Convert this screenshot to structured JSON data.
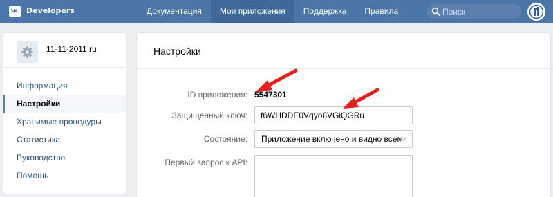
{
  "header": {
    "brand": "Developers",
    "nav": [
      {
        "label": "Документация",
        "active": false
      },
      {
        "label": "Мои приложения",
        "active": true
      },
      {
        "label": "Поддержка",
        "active": false
      },
      {
        "label": "Правила",
        "active": false
      }
    ],
    "search_placeholder": "Поиск",
    "logo_icon": "vk-logo-icon",
    "avatar_icon": "user-avatar"
  },
  "sidebar": {
    "app_name": "11-11-2011.ru",
    "app_icon": "gear-icon",
    "items": [
      {
        "label": "Информация",
        "active": false
      },
      {
        "label": "Настройки",
        "active": true
      },
      {
        "label": "Хранимые процедуры",
        "active": false
      },
      {
        "label": "Статистика",
        "active": false
      },
      {
        "label": "Руководство",
        "active": false
      },
      {
        "label": "Помощь",
        "active": false
      }
    ]
  },
  "main": {
    "title": "Настройки",
    "app_id_label": "ID приложения:",
    "app_id_value": "5547301",
    "secret_key_label": "Защищенный ключ:",
    "secret_key_value": "f6WHDDE0Vqyo8VGiQGRu",
    "state_label": "Состояние:",
    "state_value": "Приложение включено и видно всем",
    "first_api_label": "Первый запрос к API:",
    "first_api_value": ""
  },
  "colors": {
    "header": "#4a76a8",
    "active_nav": "#3d6898",
    "link": "#2a5885",
    "arrow": "#e8201c"
  }
}
